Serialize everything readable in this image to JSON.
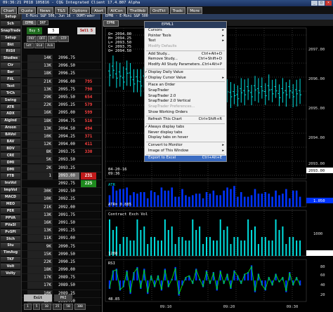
{
  "window": {
    "title": "09:36:21   P018   105816 - CQG Integrated Client 17.4.807 Alpha"
  },
  "menubar": [
    "Chart",
    "Quote",
    "News",
    "T&S",
    "Options",
    "Alert",
    "AllCon",
    "TheWeb",
    "OrdTkt",
    "Tradc",
    "More"
  ],
  "left_panel": [
    "Setup",
    "Sch",
    "SnapTrader",
    "Setup",
    "Bkt",
    "RtSil",
    "Studies",
    "Ctr",
    "Bar",
    "FilL",
    "Text",
    "TrCh",
    "Swing",
    "ATR",
    "ADX",
    "AlgInd",
    "Aroon",
    "BAVol",
    "BAV",
    "BDV",
    "CRE",
    "DMI",
    "DMI",
    "FTB",
    "InsVol",
    "ImpVol",
    "MACD",
    "MEO",
    "PER",
    "PPVA",
    "PVaSI",
    "PvSPI",
    "Stch",
    "Stu",
    "TimAvg",
    "TKF",
    "Volt",
    "Volty"
  ],
  "dom": {
    "title": "E-Mini S&P 500, Jun 16 - DOMTrader",
    "symbol": "EPM6",
    "tabs": [
      "EPM6",
      "DRF"
    ],
    "buy_label": "Buy 5",
    "sell_label": "Sell 5",
    "qty": "5",
    "small_buttons": [
      "PAY",
      "OFF",
      "LMT",
      "STP"
    ],
    "row2": [
      "Sdt",
      "Bid",
      "Ask"
    ],
    "exit_label": "Exit",
    "exit2_label": "PKI",
    "page_buttons": [
      "1",
      "5",
      "10",
      "25",
      "50",
      "100"
    ],
    "rows": [
      {
        "bid": "14K",
        "price": "2096.75",
        "ask": ""
      },
      {
        "bid": "13K",
        "price": "2096.50",
        "ask": ""
      },
      {
        "bid": "18K",
        "price": "2096.25",
        "ask": ""
      },
      {
        "bid": "21K",
        "price": "2096.00",
        "ask": "795"
      },
      {
        "bid": "13K",
        "price": "2095.75",
        "ask": "790"
      },
      {
        "bid": "29K",
        "price": "2095.50",
        "ask": "654"
      },
      {
        "bid": "22K",
        "price": "2095.25",
        "ask": "579"
      },
      {
        "bid": "16K",
        "price": "2095.00",
        "ask": "599"
      },
      {
        "bid": "18K",
        "price": "2094.75",
        "ask": "516"
      },
      {
        "bid": "13K",
        "price": "2094.50",
        "ask": "494"
      },
      {
        "bid": "10K",
        "price": "2094.25",
        "ask": "371"
      },
      {
        "bid": "12K",
        "price": "2094.00",
        "ask": "411"
      },
      {
        "bid": "8K",
        "price": "2093.75",
        "ask": "330"
      },
      {
        "bid": "5K",
        "price": "2093.50",
        "ask": ""
      },
      {
        "bid": "2K",
        "price": "2093.25",
        "ask": ""
      },
      {
        "bid": "1",
        "price": "2093.00",
        "ask": "231"
      },
      {
        "bid": "",
        "price": "2092.75",
        "ask": "225"
      },
      {
        "bid": "30K",
        "price": "2092.50",
        "ask": ""
      },
      {
        "bid": "10K",
        "price": "2092.25",
        "ask": ""
      },
      {
        "bid": "21K",
        "price": "2092.00",
        "ask": ""
      },
      {
        "bid": "13K",
        "price": "2091.75",
        "ask": ""
      },
      {
        "bid": "16K",
        "price": "2091.50",
        "ask": ""
      },
      {
        "bid": "13K",
        "price": "2091.25",
        "ask": ""
      },
      {
        "bid": "11K",
        "price": "2091.00",
        "ask": ""
      },
      {
        "bid": "9K",
        "price": "2090.75",
        "ask": ""
      },
      {
        "bid": "15K",
        "price": "2090.50",
        "ask": ""
      },
      {
        "bid": "22K",
        "price": "2090.25",
        "ask": ""
      },
      {
        "bid": "18K",
        "price": "2090.00",
        "ask": ""
      },
      {
        "bid": "17K",
        "price": "2089.75",
        "ask": ""
      },
      {
        "bid": "17K",
        "price": "2089.50",
        "ask": ""
      },
      {
        "bid": "10K",
        "price": "2089.25",
        "ask": ""
      },
      {
        "bid": "12K",
        "price": "2089.00",
        "ask": ""
      }
    ]
  },
  "chart": {
    "title": "EPM6 - E-Mini S&P 500",
    "tab": "EPM6",
    "ohlc_text": [
      "O= 2094.00",
      "H= 2094.25",
      "L= 2093.50",
      "C= 2093.75",
      "O= 2094.50"
    ],
    "price_axis": [
      "2097.00",
      "2096.00",
      "2095.00",
      "2094.00",
      "2093.00"
    ],
    "last_price": "2093.00",
    "date_text": [
      "04-20-16",
      "09:36"
    ],
    "atr_label": "ATR",
    "atr_value": "1.050",
    "atr_readout": "ATR= 0.885",
    "vol_label": "Contract Exch Vol",
    "vol_value": "1000",
    "vol_readout": "1288",
    "rsi_label": "RSI",
    "rsi_values": [
      "80",
      "60",
      "40",
      "20"
    ],
    "rsi_readout": "48.85",
    "time_axis": [
      "09:10",
      "09:20",
      "09:30"
    ]
  },
  "context_menu": {
    "header": "EPML1",
    "items": [
      {
        "label": "Cursors",
        "arrow": true
      },
      {
        "label": "Pointer Tools",
        "arrow": true
      },
      {
        "label": "Text",
        "arrow": true
      },
      {
        "label": "Modify Defaults",
        "disabled": true
      },
      {
        "sep": true
      },
      {
        "label": "Add Study...",
        "shortcut": "Ctrl+Alt+D"
      },
      {
        "label": "Remove Study...",
        "shortcut": "Ctrl+Shift+D"
      },
      {
        "label": "Modify All Study Parameters...",
        "shortcut": "Ctrl+Alt+P"
      },
      {
        "sep": true
      },
      {
        "label": "Display Daily Value",
        "check": true
      },
      {
        "label": "Display Cursor Value",
        "check": true,
        "arrow": true
      },
      {
        "sep": true
      },
      {
        "label": "Place an Order"
      },
      {
        "label": "SnapTrader"
      },
      {
        "label": "SnapTrader 2.0"
      },
      {
        "label": "SnapTrader 2.0 Vertical"
      },
      {
        "label": "SnapTrader Preferences...",
        "disabled": true
      },
      {
        "label": "Show Working Orders"
      },
      {
        "sep": true
      },
      {
        "label": "Refresh This Chart",
        "shortcut": "Ctrl+Shift+R"
      },
      {
        "sep": true
      },
      {
        "label": "Always display tabs",
        "check": true
      },
      {
        "label": "Never display tabs"
      },
      {
        "label": "Display tabs on hover"
      },
      {
        "sep": true
      },
      {
        "label": "Convert to Monitor",
        "arrow": true
      },
      {
        "label": "Image of This Window",
        "arrow": true
      },
      {
        "sep": true
      },
      {
        "label": "Export to Excel",
        "shortcut": "Ctrl+Alt+E",
        "selected": true
      }
    ]
  },
  "colors": {
    "up": "#00e0e0",
    "bar": "#0033ff",
    "vol": "#00e0e0",
    "rsi": "#00ff00",
    "bg": "#000000"
  }
}
